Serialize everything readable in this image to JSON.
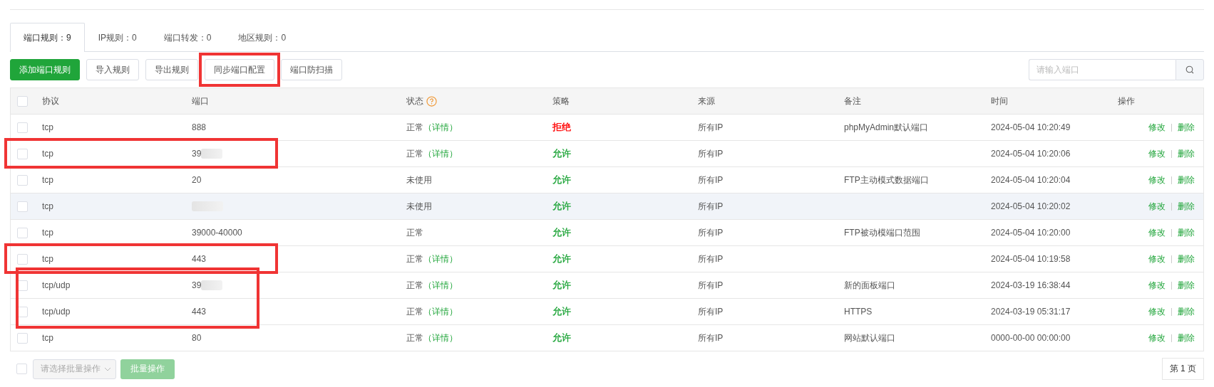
{
  "tabs": [
    {
      "label": "端口规则：9",
      "selected": true
    },
    {
      "label": "IP规则：0",
      "selected": false
    },
    {
      "label": "端口转发：0",
      "selected": false
    },
    {
      "label": "地区规则：0",
      "selected": false
    }
  ],
  "toolbar": {
    "buttons": [
      {
        "label": "添加端口规则",
        "kind": "primary",
        "highlighted": false
      },
      {
        "label": "导入规则",
        "kind": "default",
        "highlighted": false
      },
      {
        "label": "导出规则",
        "kind": "default",
        "highlighted": false
      },
      {
        "label": "同步端口配置",
        "kind": "default",
        "highlighted": true
      },
      {
        "label": "端口防扫描",
        "kind": "default",
        "highlighted": false
      }
    ],
    "search": {
      "placeholder": "请输入端口"
    }
  },
  "table": {
    "columns": [
      "协议",
      "端口",
      "状态",
      "策略",
      "来源",
      "备注",
      "时间",
      "操作"
    ],
    "rows": [
      {
        "checked": false,
        "hovered": false,
        "protocol": "tcp",
        "port": "888",
        "redacted": false,
        "status": "正常",
        "details": "（详情）",
        "policy": "拒绝",
        "color": "#ff0000",
        "highlighted": false,
        "source": "所有IP",
        "remark": "phpMyAdmin默认端口",
        "time": "2024-05-04 10:20:49",
        "actions": [
          "修改",
          "删除"
        ]
      },
      {
        "checked": false,
        "hovered": false,
        "protocol": "tcp",
        "port": "39",
        "redacted": true,
        "status": "正常",
        "details": "（详情）",
        "policy": "允许",
        "color": "#20a53a",
        "highlighted": true,
        "source": "所有IP",
        "time": "2024-05-04 10:20:06",
        "actions": [
          "修改",
          "删除"
        ]
      },
      {
        "checked": false,
        "hovered": false,
        "protocol": "tcp",
        "port": "20",
        "redacted": false,
        "status": "未使用",
        "policy": "允许",
        "color": "#20a53a",
        "highlighted": false,
        "source": "所有IP",
        "remark": "FTP主动模式数据端口",
        "time": "2024-05-04 10:20:04",
        "actions": [
          "修改",
          "删除"
        ]
      },
      {
        "checked": false,
        "hovered": true,
        "protocol": "tcp",
        "redacted": true,
        "status": "未使用",
        "policy": "允许",
        "color": "#20a53a",
        "highlighted": false,
        "source": "所有IP",
        "time": "2024-05-04 10:20:02",
        "actions": [
          "修改",
          "删除"
        ]
      },
      {
        "checked": false,
        "hovered": false,
        "protocol": "tcp",
        "port": "39000-40000",
        "redacted": false,
        "status": "正常",
        "policy": "允许",
        "color": "#20a53a",
        "highlighted": false,
        "source": "所有IP",
        "remark": "FTP被动模端口范围",
        "time": "2024-05-04 10:20:00",
        "actions": [
          "修改",
          "删除"
        ]
      },
      {
        "checked": false,
        "hovered": false,
        "protocol": "tcp",
        "port": "443",
        "redacted": false,
        "status": "正常",
        "details": "（详情）",
        "policy": "允许",
        "color": "#20a53a",
        "highlighted": true,
        "source": "所有IP",
        "time": "2024-05-04 10:19:58",
        "actions": [
          "修改",
          "删除"
        ]
      },
      {
        "checked": false,
        "hovered": false,
        "protocol": "tcp/udp",
        "port": "39",
        "redacted": true,
        "status": "正常",
        "details": "（详情）",
        "policy": "允许",
        "color": "#20a53a",
        "highlighted": true,
        "highlight_continues": true,
        "source": "所有IP",
        "remark": "新的面板端口",
        "time": "2024-03-19 16:38:44",
        "actions": [
          "修改",
          "删除"
        ]
      },
      {
        "checked": false,
        "hovered": false,
        "protocol": "tcp/udp",
        "port": "443",
        "redacted": false,
        "status": "正常",
        "details": "（详情）",
        "policy": "允许",
        "color": "#20a53a",
        "highlighted": true,
        "source": "所有IP",
        "remark": "HTTPS",
        "time": "2024-03-19 05:31:17",
        "actions": [
          "修改",
          "删除"
        ]
      },
      {
        "checked": false,
        "hovered": false,
        "protocol": "tcp",
        "port": "80",
        "redacted": false,
        "status": "正常",
        "details": "（详情）",
        "policy": "允许",
        "color": "#20a53a",
        "highlighted": false,
        "source": "所有IP",
        "remark": "网站默认端口",
        "time": "0000-00-00 00:00:00",
        "actions": [
          "修改",
          "删除"
        ]
      }
    ]
  },
  "footer": {
    "select_all_checked": false,
    "batch_select": {
      "placeholder": "请选择批量操作",
      "disabled": true
    },
    "batch_button": {
      "label": "批量操作",
      "disabled": true
    },
    "page": "第 1 页"
  }
}
